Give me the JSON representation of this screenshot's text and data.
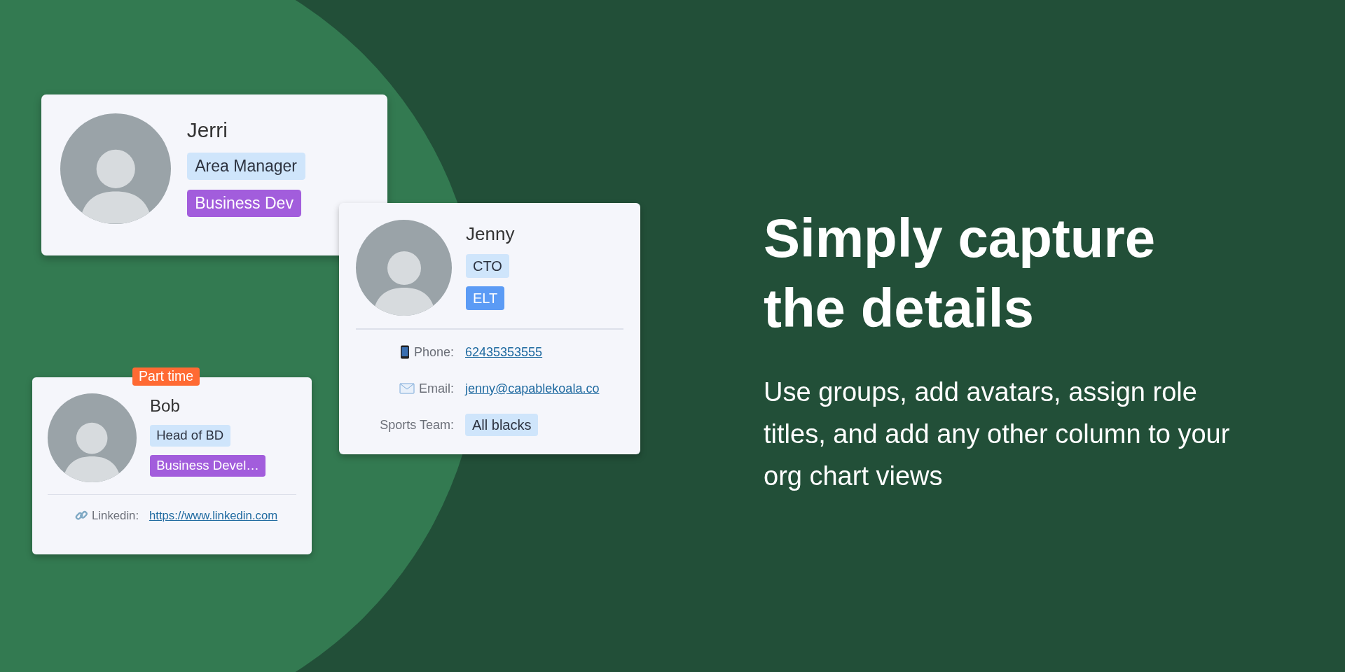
{
  "cards": [
    {
      "name": "Jerri",
      "tags": [
        {
          "label": "Area Manager",
          "color": "#cfe5fb"
        },
        {
          "label": "Business Dev",
          "color": "#a25ddc"
        }
      ]
    },
    {
      "name": "Jenny",
      "tags": [
        {
          "label": "CTO",
          "color": "#cfe5fb"
        },
        {
          "label": "ELT",
          "color": "#5b9bf5"
        }
      ],
      "fields": [
        {
          "kind": "phone",
          "label": "Phone:",
          "value": "62435353555"
        },
        {
          "kind": "email",
          "label": "Email:",
          "value": "jenny@capablekoala.co"
        },
        {
          "kind": "team",
          "label": "Sports Team:",
          "value": "All blacks"
        }
      ]
    },
    {
      "name": "Bob",
      "badge": "Part time",
      "tags": [
        {
          "label": "Head of BD",
          "color": "#cfe5fb"
        },
        {
          "label": "Business Devel…",
          "color": "#a25ddc"
        }
      ],
      "fields": [
        {
          "kind": "linkedin",
          "label": "Linkedin:",
          "value": "https://www.linkedin.com"
        }
      ]
    }
  ],
  "headline": [
    "Simply capture",
    "the details"
  ],
  "description": "Use groups, add avatars, assign role titles, and add any other column to your org chart views"
}
